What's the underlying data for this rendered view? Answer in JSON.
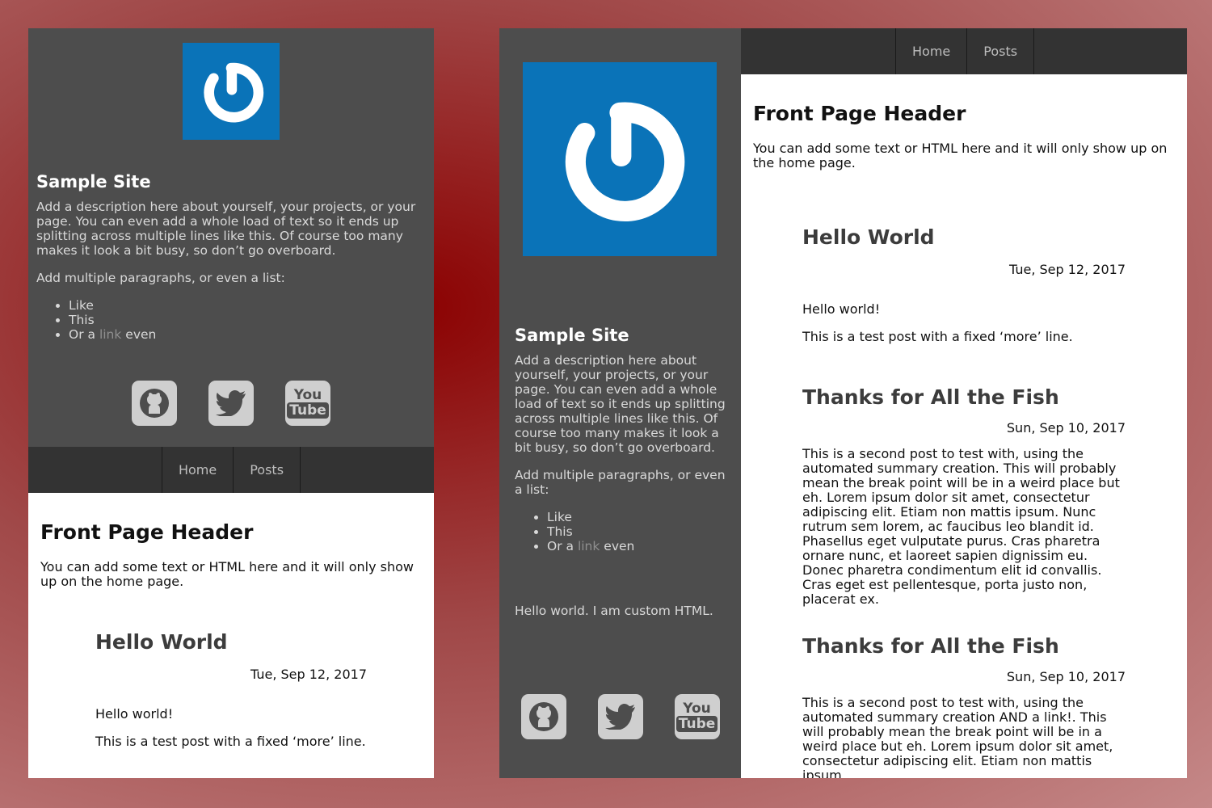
{
  "site": {
    "title": "Sample Site",
    "description": "Add a description here about yourself, your projects, or your page. You can even add a whole load of text so it ends up splitting across multiple lines like this. Of course too many makes it look a bit busy, so don’t go overboard.",
    "list_intro": "Add multiple paragraphs, or even a list:",
    "list": [
      "Like",
      "This"
    ],
    "list_last_prefix": "Or a",
    "list_last_link": "link",
    "list_last_suffix": "even",
    "custom_html": "Hello world. I am custom HTML."
  },
  "nav": [
    "Home",
    "Posts"
  ],
  "icons": {
    "logo": "power-logo",
    "social": [
      "github-icon",
      "twitter-icon",
      "youtube-icon"
    ],
    "youtube_text": [
      "You",
      "Tube"
    ]
  },
  "front": {
    "header": "Front Page Header",
    "intro": "You can add some text or HTML here and it will only show up on the home page."
  },
  "posts": [
    {
      "title": "Hello World",
      "date": "Tue, Sep 12, 2017",
      "paragraphs": [
        "Hello world!",
        "This is a test post with a fixed ‘more’ line."
      ]
    },
    {
      "title": "Thanks for All the Fish",
      "date": "Sun, Sep 10, 2017",
      "paragraphs": [
        "This is a second post to test with, using the automated summary creation. This will probably mean the break point will be in a weird place but eh. Lorem ipsum dolor sit amet, consectetur adipiscing elit. Etiam non mattis ipsum. Nunc rutrum sem lorem, ac faucibus leo blandit id. Phasellus eget vulputate purus. Cras pharetra ornare nunc, et laoreet sapien dignissim eu. Donec pharetra condimentum elit id convallis. Cras eget est pellentesque, porta justo non, placerat ex."
      ]
    },
    {
      "title": "Thanks for All the Fish",
      "date": "Sun, Sep 10, 2017",
      "paragraphs": [
        "This is a second post to test with, using the automated summary creation AND a link!. This will probably mean the break point will be in a weird place but eh. Lorem ipsum dolor sit amet, consectetur adipiscing elit. Etiam non mattis ipsum."
      ]
    }
  ],
  "colors": {
    "logo_bg": "#0a73b8",
    "sidebar_bg": "#4d4d4d",
    "nav_bg": "#333333",
    "link": "#8f8f8f"
  }
}
